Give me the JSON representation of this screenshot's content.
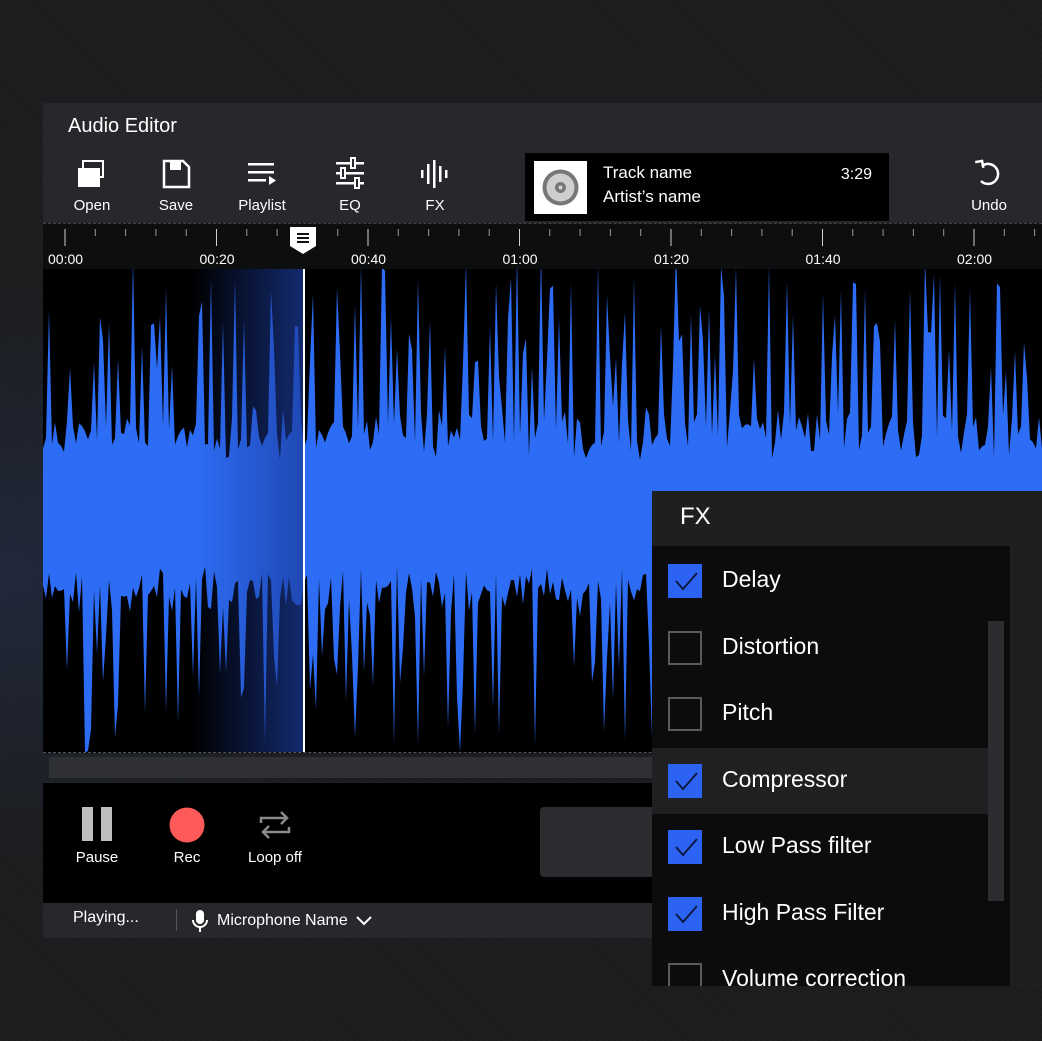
{
  "app": {
    "title": "Audio Editor"
  },
  "toolbar": {
    "open": {
      "label": "Open",
      "icon": "folder-icon"
    },
    "save": {
      "label": "Save",
      "icon": "save-icon"
    },
    "playlist": {
      "label": "Playlist",
      "icon": "playlist-icon"
    },
    "eq": {
      "label": "EQ",
      "icon": "equalizer-icon"
    },
    "fx": {
      "label": "FX",
      "icon": "waveform-icon"
    },
    "undo": {
      "label": "Undo",
      "icon": "undo-icon"
    }
  },
  "now_playing": {
    "track": "Track name",
    "artist": "Artist’s name",
    "duration": "3:29",
    "cover_icon": "vinyl-disc-icon"
  },
  "timeline": {
    "labels": [
      "00:00",
      "00:20",
      "00:40",
      "01:00",
      "01:20",
      "01:40",
      "02:00"
    ],
    "playhead_time": "00:34",
    "selection": {
      "start": "00:18",
      "end": "00:34"
    }
  },
  "transport": {
    "pause": {
      "label": "Pause",
      "icon": "pause-icon"
    },
    "rec": {
      "label": "Rec",
      "icon": "record-icon"
    },
    "loop": {
      "label": "Loop off",
      "icon": "loop-icon"
    }
  },
  "status": {
    "text": "Playing...",
    "microphone": "Microphone Name",
    "mic_icon": "microphone-icon"
  },
  "fx_panel": {
    "title": "FX",
    "items": [
      {
        "label": "Delay",
        "checked": true
      },
      {
        "label": "Distortion",
        "checked": false
      },
      {
        "label": "Pitch",
        "checked": false
      },
      {
        "label": "Compressor",
        "checked": true,
        "highlighted": true
      },
      {
        "label": "Low Pass filter",
        "checked": true
      },
      {
        "label": "High Pass Filter",
        "checked": true
      },
      {
        "label": "Volume correction",
        "checked": false
      }
    ]
  },
  "colors": {
    "accent": "#2d63f2",
    "waveform": "#2d6df6",
    "record": "#ff5a5a",
    "background": "#1b1c1e"
  }
}
